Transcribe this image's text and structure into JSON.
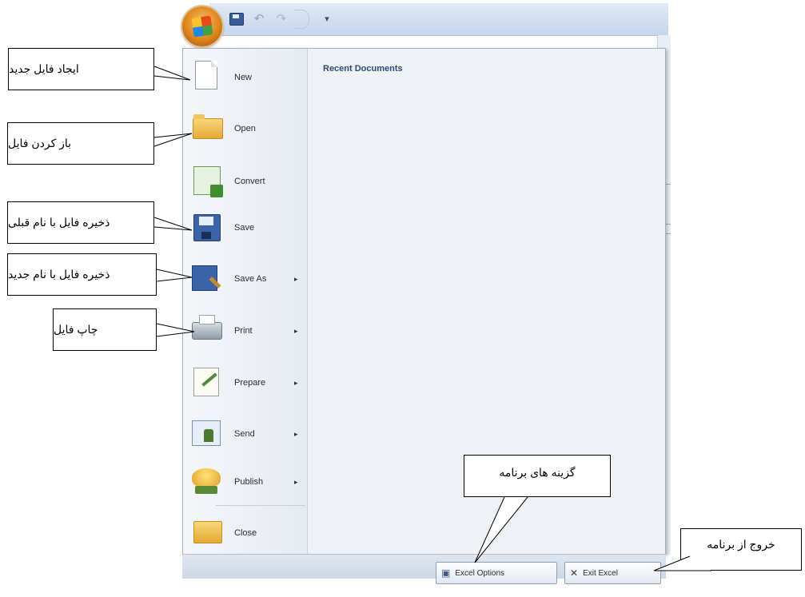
{
  "quick_access": {
    "office_button": "office-button",
    "save": "save-icon",
    "undo": "undo-icon",
    "redo": "redo-icon",
    "customize": "▾"
  },
  "menu": {
    "recent_title": "Recent Documents",
    "items": [
      {
        "label": "New",
        "icon": "new-document-icon",
        "has_submenu": false
      },
      {
        "label": "Open",
        "icon": "open-folder-icon",
        "has_submenu": false
      },
      {
        "label": "Convert",
        "icon": "convert-icon",
        "has_submenu": false
      },
      {
        "label": "Save",
        "icon": "save-disk-icon",
        "has_submenu": false
      },
      {
        "label": "Save As",
        "icon": "save-as-icon",
        "has_submenu": true
      },
      {
        "label": "Print",
        "icon": "printer-icon",
        "has_submenu": true
      },
      {
        "label": "Prepare",
        "icon": "prepare-icon",
        "has_submenu": true
      },
      {
        "label": "Send",
        "icon": "send-icon",
        "has_submenu": true
      },
      {
        "label": "Publish",
        "icon": "publish-icon",
        "has_submenu": true
      },
      {
        "label": "Close",
        "icon": "close-folder-icon",
        "has_submenu": false
      }
    ],
    "submenu_arrow": "▸"
  },
  "bottom": {
    "options_label": "Excel Options",
    "exit_label": "Exit Excel"
  },
  "callouts": {
    "new": "ایجاد فایل جدید",
    "open": "باز کردن فایل",
    "save": "ذخیره فایل با نام قبلی",
    "save_as": "ذخیره فایل با نام جدید",
    "print": "چاپ فایل",
    "options": "گزینه های برنامه",
    "exit": "خروج از برنامه"
  },
  "colors": {
    "menu_bg": "#eceff4",
    "title_blue": "#2e4a74",
    "office_orange": "#e0851a"
  }
}
